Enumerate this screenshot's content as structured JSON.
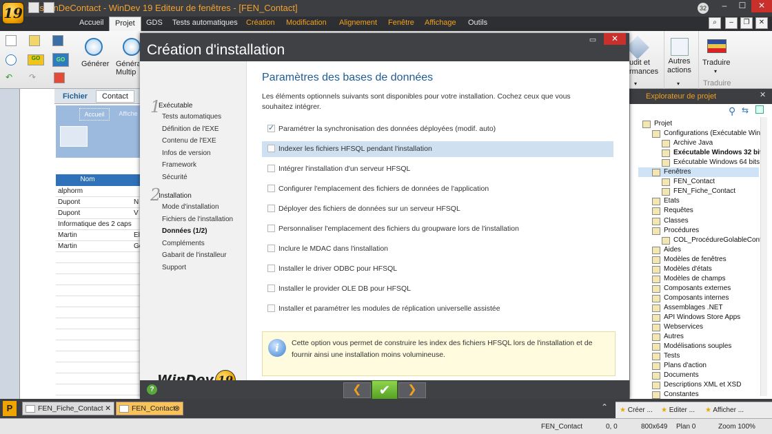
{
  "app": {
    "title": "GestionDeContact - WinDev 19  Editeur de fenêtres - [FEN_Contact]",
    "logo_letter": "19",
    "badge": "32"
  },
  "window_controls": {
    "minimize": "–",
    "maximize": "☐",
    "close": "✕"
  },
  "menu": [
    {
      "label": "Accueil",
      "style": "normal"
    },
    {
      "label": "Projet",
      "style": "active"
    },
    {
      "label": "GDS",
      "style": "normal"
    },
    {
      "label": "Tests automatiques",
      "style": "normal"
    },
    {
      "label": "Création",
      "style": "orange"
    },
    {
      "label": "Modification",
      "style": "orange"
    },
    {
      "label": "Alignement",
      "style": "orange"
    },
    {
      "label": "Fenêtre",
      "style": "orange"
    },
    {
      "label": "Affichage",
      "style": "orange"
    },
    {
      "label": "Outils",
      "style": "normal"
    }
  ],
  "ribbon": {
    "generer": "Générer",
    "generer_multi": "Généra\nMultip",
    "audit": "udit et\nrmances",
    "autres_actions": "Autres\nactions",
    "traduire": "Traduire",
    "traduire_group": "Traduire"
  },
  "left_doc": {
    "tabs": [
      "Fichier",
      "Contact"
    ],
    "subtabs": [
      "Accueil",
      "Affiche"
    ],
    "column": "Nom",
    "rows": [
      [
        "alphorm",
        ""
      ],
      [
        "Dupont",
        "N"
      ],
      [
        "Dupont",
        "V"
      ],
      [
        "Informatique des 2 caps",
        ""
      ],
      [
        "Martin",
        "El"
      ],
      [
        "Martin",
        "Ge"
      ]
    ]
  },
  "dialog": {
    "title": "Création d'installation",
    "steps": {
      "group1_num": "1",
      "group1_label": "Exécutable",
      "group1": [
        "Tests automatiques",
        "Définition de l'EXE",
        "Contenu de l'EXE",
        "Infos de version",
        "Framework",
        "Sécurité"
      ],
      "group2_num": "2",
      "group2_label": "Installation",
      "group2": [
        "Mode d'installation",
        "Fichiers de l'installation",
        "Données (1/2)",
        "Compléments",
        "Gabarit de l'installeur",
        "Support"
      ]
    },
    "brand": "WinDev",
    "brand_version": "19",
    "content_title": "Paramètres des bases de données",
    "intro": "Les éléments optionnels suivants sont disponibles pour votre installation. Cochez ceux que vous souhaitez intégrer.",
    "options": [
      {
        "label": "Paramétrer la synchronisation des données déployées (modif. auto)",
        "checked": true
      },
      {
        "label": "Indexer les fichiers HFSQL pendant l'installation",
        "checked": false,
        "highlight": true
      },
      {
        "label": "Intégrer l'installation d'un serveur HFSQL",
        "checked": false
      },
      {
        "label": "Configurer l'emplacement des fichiers de données de l'application",
        "checked": false
      },
      {
        "label": "Déployer des fichiers de données sur un serveur HFSQL",
        "checked": false
      },
      {
        "label": "Personnaliser l'emplacement des fichiers du groupware lors de l'installation",
        "checked": false
      },
      {
        "label": "Inclure le MDAC dans l'installation",
        "checked": false
      },
      {
        "label": "Installer le driver ODBC pour HFSQL",
        "checked": false
      },
      {
        "label": "Installer le provider OLE DB pour HFSQL",
        "checked": false
      },
      {
        "label": "Installer et paramétrer les modules de réplication universelle assistée",
        "checked": false
      }
    ],
    "info": "Cette option vous permet de construire les index des fichiers HFSQL lors de l'installation et de fournir ainsi une installation moins volumineuse.",
    "footer": {
      "help": "?",
      "prev": "❮",
      "ok": "✔",
      "next": "❯"
    }
  },
  "explorer": {
    "title": "Explorateur de projet",
    "items": [
      {
        "label": "Projet",
        "level": 0
      },
      {
        "label": "Configurations (Exécutable Windo",
        "level": 1
      },
      {
        "label": "Archive Java",
        "level": 2
      },
      {
        "label": "Exécutable Windows 32 bits",
        "level": 2,
        "bold": true
      },
      {
        "label": "Exécutable Windows 64 bits",
        "level": 2
      },
      {
        "label": "Fenêtres",
        "level": 1,
        "selected": true
      },
      {
        "label": "FEN_Contact",
        "level": 2
      },
      {
        "label": "FEN_Fiche_Contact",
        "level": 2
      },
      {
        "label": "Etats",
        "level": 1
      },
      {
        "label": "Requêtes",
        "level": 1
      },
      {
        "label": "Classes",
        "level": 1
      },
      {
        "label": "Procédures",
        "level": 1
      },
      {
        "label": "COL_ProcédureGolableContact",
        "level": 2
      },
      {
        "label": "Aides",
        "level": 1
      },
      {
        "label": "Modèles de fenêtres",
        "level": 1
      },
      {
        "label": "Modèles d'états",
        "level": 1
      },
      {
        "label": "Modèles de champs",
        "level": 1
      },
      {
        "label": "Composants externes",
        "level": 1
      },
      {
        "label": "Composants internes",
        "level": 1
      },
      {
        "label": "Assemblages .NET",
        "level": 1
      },
      {
        "label": "API Windows Store Apps",
        "level": 1
      },
      {
        "label": "Webservices",
        "level": 1
      },
      {
        "label": "Autres",
        "level": 1
      },
      {
        "label": "Modélisations souples",
        "level": 1
      },
      {
        "label": "Tests",
        "level": 1
      },
      {
        "label": "Plans d'action",
        "level": 1
      },
      {
        "label": "Documents",
        "level": 1
      },
      {
        "label": "Descriptions XML et XSD",
        "level": 1
      },
      {
        "label": "Constantes",
        "level": 1
      }
    ],
    "footer": [
      "Créer ...",
      "Editer ...",
      "Afficher ..."
    ]
  },
  "bottom_tabs": [
    {
      "label": "FEN_Fiche_Contact",
      "active": false
    },
    {
      "label": "FEN_Contact",
      "active": true
    }
  ],
  "status": {
    "window": "FEN_Contact",
    "coords": "0, 0",
    "size": "800x649",
    "plan": "Plan 0",
    "zoom": "Zoom 100%"
  }
}
